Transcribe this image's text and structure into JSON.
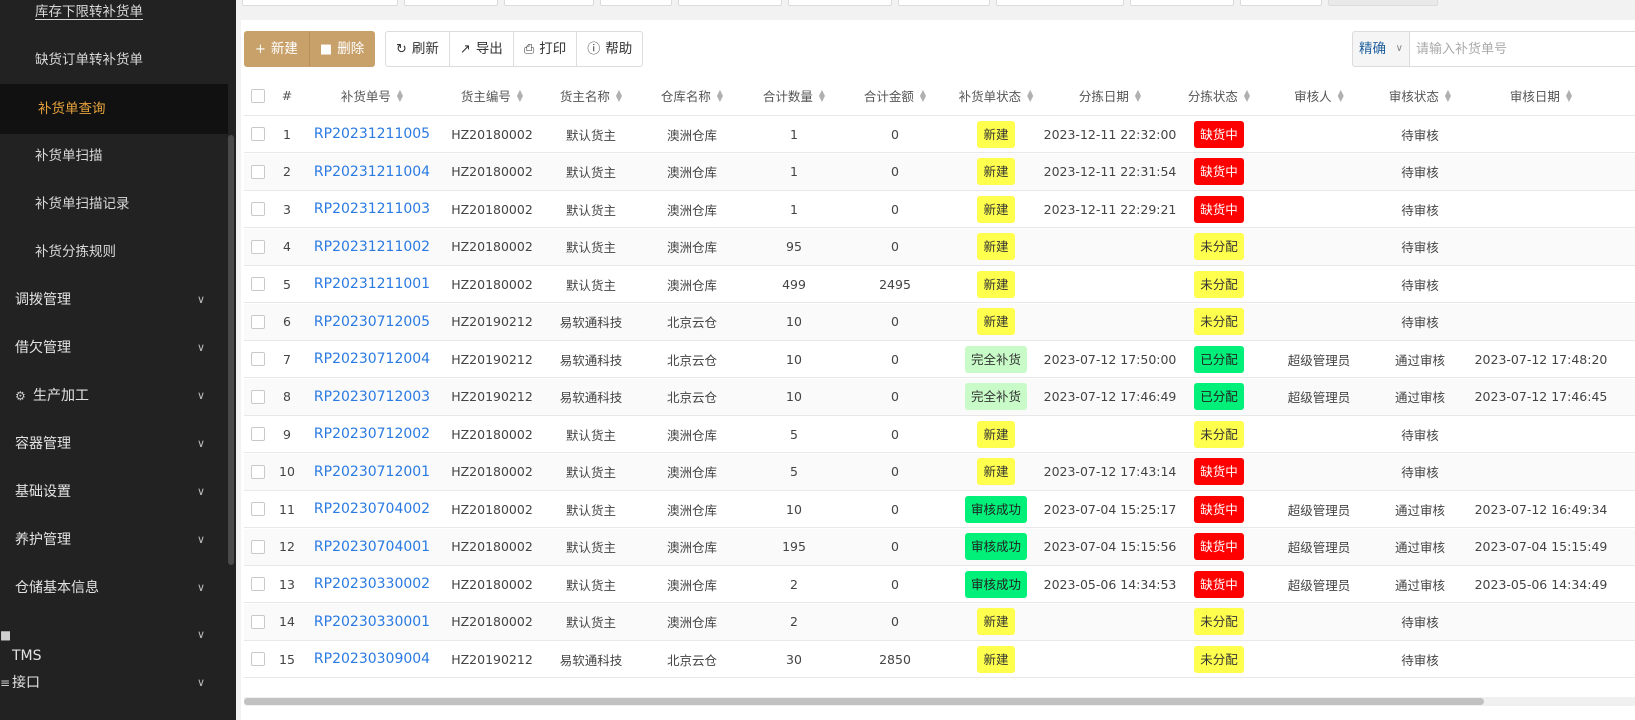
{
  "sidebar": {
    "sub_items": [
      {
        "label": "库存下限转补货单"
      },
      {
        "label": "缺货订单转补货单"
      },
      {
        "label": "补货单查询"
      },
      {
        "label": "补货单扫描"
      },
      {
        "label": "补货单扫描记录"
      },
      {
        "label": "补货分拣规则"
      }
    ],
    "groups": [
      {
        "label": "调拨管理"
      },
      {
        "label": "借欠管理"
      },
      {
        "label": "生产加工"
      },
      {
        "label": "容器管理"
      },
      {
        "label": "基础设置"
      },
      {
        "label": "养护管理"
      },
      {
        "label": "仓储基本信息"
      },
      {
        "label": "TMS"
      },
      {
        "label": "接口"
      }
    ]
  },
  "toolbar": {
    "new_label": "新建",
    "delete_label": "删除",
    "refresh_label": "刷新",
    "export_label": "导出",
    "print_label": "打印",
    "help_label": "帮助"
  },
  "search": {
    "mode": "精确",
    "placeholder": "请输入补货单号"
  },
  "colors": {
    "sidebar_bg": "#222222",
    "active_text": "#e6a23c",
    "primary_button": "#c8a06a",
    "link": "#2a7ae2",
    "tag_new": "#ffff4d",
    "tag_full": "#c8fbc8",
    "tag_success": "#00f07a",
    "tag_shortage": "#ff0000"
  },
  "table": {
    "headers": {
      "index": "#",
      "order_no": "补货单号",
      "owner_code": "货主编号",
      "owner_name": "货主名称",
      "warehouse": "仓库名称",
      "total_qty": "合计数量",
      "total_amount": "合计金额",
      "order_status": "补货单状态",
      "pick_date": "分拣日期",
      "pick_status": "分拣状态",
      "reviewer": "审核人",
      "review_status": "审核状态",
      "review_date": "审核日期"
    },
    "rows": [
      {
        "index": "1",
        "order_no": "RP20231211005",
        "owner_code": "HZ20180002",
        "owner_name": "默认货主",
        "warehouse": "澳洲仓库",
        "total_qty": "1",
        "total_amount": "0",
        "order_status": "新建",
        "pick_date": "2023-12-11 22:32:00",
        "pick_status": "缺货中",
        "reviewer": "",
        "review_status": "待审核",
        "review_date": ""
      },
      {
        "index": "2",
        "order_no": "RP20231211004",
        "owner_code": "HZ20180002",
        "owner_name": "默认货主",
        "warehouse": "澳洲仓库",
        "total_qty": "1",
        "total_amount": "0",
        "order_status": "新建",
        "pick_date": "2023-12-11 22:31:54",
        "pick_status": "缺货中",
        "reviewer": "",
        "review_status": "待审核",
        "review_date": ""
      },
      {
        "index": "3",
        "order_no": "RP20231211003",
        "owner_code": "HZ20180002",
        "owner_name": "默认货主",
        "warehouse": "澳洲仓库",
        "total_qty": "1",
        "total_amount": "0",
        "order_status": "新建",
        "pick_date": "2023-12-11 22:29:21",
        "pick_status": "缺货中",
        "reviewer": "",
        "review_status": "待审核",
        "review_date": ""
      },
      {
        "index": "4",
        "order_no": "RP20231211002",
        "owner_code": "HZ20180002",
        "owner_name": "默认货主",
        "warehouse": "澳洲仓库",
        "total_qty": "95",
        "total_amount": "0",
        "order_status": "新建",
        "pick_date": "",
        "pick_status": "未分配",
        "reviewer": "",
        "review_status": "待审核",
        "review_date": ""
      },
      {
        "index": "5",
        "order_no": "RP20231211001",
        "owner_code": "HZ20180002",
        "owner_name": "默认货主",
        "warehouse": "澳洲仓库",
        "total_qty": "499",
        "total_amount": "2495",
        "order_status": "新建",
        "pick_date": "",
        "pick_status": "未分配",
        "reviewer": "",
        "review_status": "待审核",
        "review_date": ""
      },
      {
        "index": "6",
        "order_no": "RP20230712005",
        "owner_code": "HZ20190212",
        "owner_name": "易软通科技",
        "warehouse": "北京云仓",
        "total_qty": "10",
        "total_amount": "0",
        "order_status": "新建",
        "pick_date": "",
        "pick_status": "未分配",
        "reviewer": "",
        "review_status": "待审核",
        "review_date": ""
      },
      {
        "index": "7",
        "order_no": "RP20230712004",
        "owner_code": "HZ20190212",
        "owner_name": "易软通科技",
        "warehouse": "北京云仓",
        "total_qty": "10",
        "total_amount": "0",
        "order_status": "完全补货",
        "pick_date": "2023-07-12 17:50:00",
        "pick_status": "已分配",
        "reviewer": "超级管理员",
        "review_status": "通过审核",
        "review_date": "2023-07-12 17:48:20"
      },
      {
        "index": "8",
        "order_no": "RP20230712003",
        "owner_code": "HZ20190212",
        "owner_name": "易软通科技",
        "warehouse": "北京云仓",
        "total_qty": "10",
        "total_amount": "0",
        "order_status": "完全补货",
        "pick_date": "2023-07-12 17:46:49",
        "pick_status": "已分配",
        "reviewer": "超级管理员",
        "review_status": "通过审核",
        "review_date": "2023-07-12 17:46:45"
      },
      {
        "index": "9",
        "order_no": "RP20230712002",
        "owner_code": "HZ20180002",
        "owner_name": "默认货主",
        "warehouse": "澳洲仓库",
        "total_qty": "5",
        "total_amount": "0",
        "order_status": "新建",
        "pick_date": "",
        "pick_status": "未分配",
        "reviewer": "",
        "review_status": "待审核",
        "review_date": ""
      },
      {
        "index": "10",
        "order_no": "RP20230712001",
        "owner_code": "HZ20180002",
        "owner_name": "默认货主",
        "warehouse": "澳洲仓库",
        "total_qty": "5",
        "total_amount": "0",
        "order_status": "新建",
        "pick_date": "2023-07-12 17:43:14",
        "pick_status": "缺货中",
        "reviewer": "",
        "review_status": "待审核",
        "review_date": ""
      },
      {
        "index": "11",
        "order_no": "RP20230704002",
        "owner_code": "HZ20180002",
        "owner_name": "默认货主",
        "warehouse": "澳洲仓库",
        "total_qty": "10",
        "total_amount": "0",
        "order_status": "审核成功",
        "pick_date": "2023-07-04 15:25:17",
        "pick_status": "缺货中",
        "reviewer": "超级管理员",
        "review_status": "通过审核",
        "review_date": "2023-07-12 16:49:34"
      },
      {
        "index": "12",
        "order_no": "RP20230704001",
        "owner_code": "HZ20180002",
        "owner_name": "默认货主",
        "warehouse": "澳洲仓库",
        "total_qty": "195",
        "total_amount": "0",
        "order_status": "审核成功",
        "pick_date": "2023-07-04 15:15:56",
        "pick_status": "缺货中",
        "reviewer": "超级管理员",
        "review_status": "通过审核",
        "review_date": "2023-07-04 15:15:49"
      },
      {
        "index": "13",
        "order_no": "RP20230330002",
        "owner_code": "HZ20180002",
        "owner_name": "默认货主",
        "warehouse": "澳洲仓库",
        "total_qty": "2",
        "total_amount": "0",
        "order_status": "审核成功",
        "pick_date": "2023-05-06 14:34:53",
        "pick_status": "缺货中",
        "reviewer": "超级管理员",
        "review_status": "通过审核",
        "review_date": "2023-05-06 14:34:49"
      },
      {
        "index": "14",
        "order_no": "RP20230330001",
        "owner_code": "HZ20180002",
        "owner_name": "默认货主",
        "warehouse": "澳洲仓库",
        "total_qty": "2",
        "total_amount": "0",
        "order_status": "新建",
        "pick_date": "",
        "pick_status": "未分配",
        "reviewer": "",
        "review_status": "待审核",
        "review_date": ""
      },
      {
        "index": "15",
        "order_no": "RP20230309004",
        "owner_code": "HZ20190212",
        "owner_name": "易软通科技",
        "warehouse": "北京云仓",
        "total_qty": "30",
        "total_amount": "2850",
        "order_status": "新建",
        "pick_date": "",
        "pick_status": "未分配",
        "reviewer": "",
        "review_status": "待审核",
        "review_date": ""
      }
    ]
  }
}
